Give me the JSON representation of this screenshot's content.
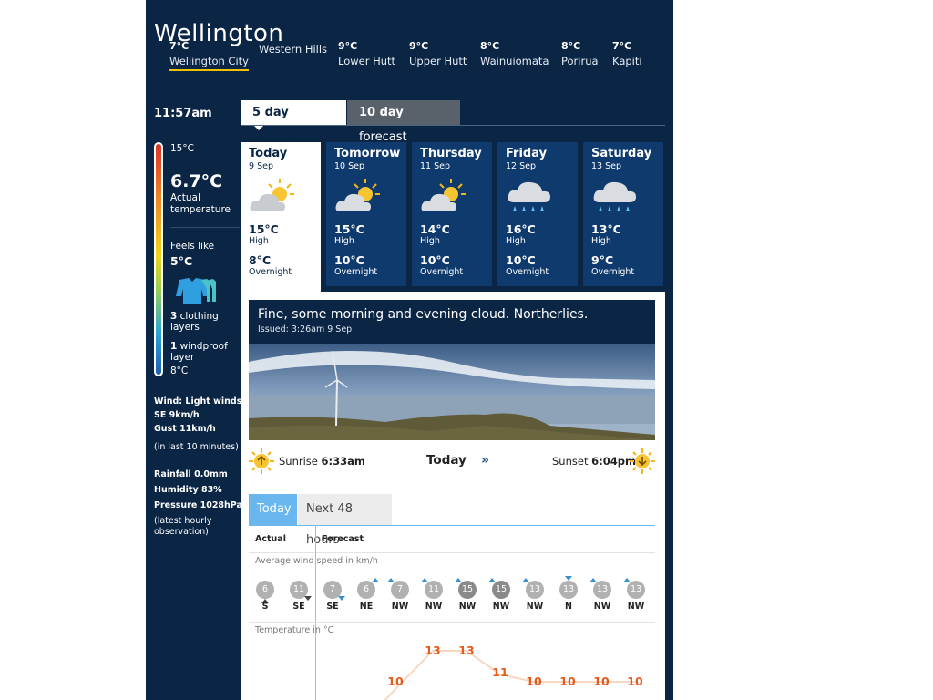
{
  "city": "Wellington",
  "locations": [
    {
      "temp": "7°C",
      "name": "Wellington City",
      "active": true
    },
    {
      "temp": "",
      "name": "Western Hills"
    },
    {
      "temp": "9°C",
      "name": "Lower Hutt"
    },
    {
      "temp": "9°C",
      "name": "Upper Hutt"
    },
    {
      "temp": "8°C",
      "name": "Wainuiomata"
    },
    {
      "temp": "8°C",
      "name": "Porirua"
    },
    {
      "temp": "7°C",
      "name": "Kapiti"
    }
  ],
  "time": "11:57am",
  "forecast_tabs": [
    {
      "bold": "5 day",
      "rest": " forecast"
    },
    {
      "bold": "10 day",
      "rest": " forecast"
    }
  ],
  "current": {
    "scale_high": "15°C",
    "actual_temp": "6.7°C",
    "actual_label_1": "Actual",
    "actual_label_2": "temperature",
    "feels_like_label": "Feels like",
    "feels_like": "5°C",
    "clothing_count": "3",
    "clothing_label_1": " clothing",
    "clothing_label_2": "layers",
    "windproof_count": "1",
    "windproof_label_1": " windproof",
    "windproof_label_2": "layer",
    "scale_low": "8°C",
    "wind": "Wind: Light winds",
    "wind_dir": "SE 9km/h",
    "gust": "Gust 11km/h",
    "wind_note": "(in last 10 minutes)",
    "rainfall": "Rainfall 0.0mm",
    "humidity": "Humidity 83%",
    "pressure": "Pressure 1028hPa",
    "obs_note_1": "(latest hourly",
    "obs_note_2": "observation)"
  },
  "days": [
    {
      "name": "Today",
      "date": "9 Sep",
      "icon": "partly-cloudy-icon",
      "high": "15°C",
      "high_label": "High",
      "low": "8°C",
      "low_label": "Overnight"
    },
    {
      "name": "Tomorrow",
      "date": "10 Sep",
      "icon": "partly-cloudy-icon",
      "high": "15°C",
      "high_label": "High",
      "low": "10°C",
      "low_label": "Overnight"
    },
    {
      "name": "Thursday",
      "date": "11 Sep",
      "icon": "partly-cloudy-icon",
      "high": "14°C",
      "high_label": "High",
      "low": "10°C",
      "low_label": "Overnight"
    },
    {
      "name": "Friday",
      "date": "12 Sep",
      "icon": "rain-cloud-icon",
      "high": "16°C",
      "high_label": "High",
      "low": "10°C",
      "low_label": "Overnight"
    },
    {
      "name": "Saturday",
      "date": "13 Sep",
      "icon": "rain-cloud-icon",
      "high": "13°C",
      "high_label": "High",
      "low": "9°C",
      "low_label": "Overnight"
    }
  ],
  "summary": {
    "text": "Fine, some morning and evening cloud. Northerlies.",
    "issued": "Issued: 3:26am 9 Sep"
  },
  "sun": {
    "sunrise_label": "Sunrise",
    "sunrise": "6:33am",
    "today": "Today",
    "sunset_label": "Sunset",
    "sunset": "6:04pm"
  },
  "detail_tabs": [
    "Today",
    "Next 48 hours"
  ],
  "detail": {
    "actual_label": "Actual",
    "forecast_label": "Forecast",
    "wind_title": "Average wind speed in km/h",
    "temp_title": "Temperature in °C",
    "wind": [
      {
        "speed": "6",
        "dir": "S"
      },
      {
        "speed": "11",
        "dir": "SE"
      },
      {
        "speed": "7",
        "dir": "SE"
      },
      {
        "speed": "6",
        "dir": "NE"
      },
      {
        "speed": "7",
        "dir": "NW"
      },
      {
        "speed": "11",
        "dir": "NW"
      },
      {
        "speed": "15",
        "dir": "NW"
      },
      {
        "speed": "15",
        "dir": "NW"
      },
      {
        "speed": "13",
        "dir": "NW"
      },
      {
        "speed": "13",
        "dir": "N"
      },
      {
        "speed": "13",
        "dir": "NW"
      },
      {
        "speed": "13",
        "dir": "NW"
      }
    ],
    "temps": [
      "10",
      "13",
      "13",
      "11",
      "10",
      "10",
      "10",
      "10"
    ]
  },
  "colors": {
    "navy": "#0b2545",
    "card": "#0f3a6e",
    "tab_blue": "#69b7ee",
    "temp_orange": "#e65a1a",
    "underline": "#f2c200"
  }
}
